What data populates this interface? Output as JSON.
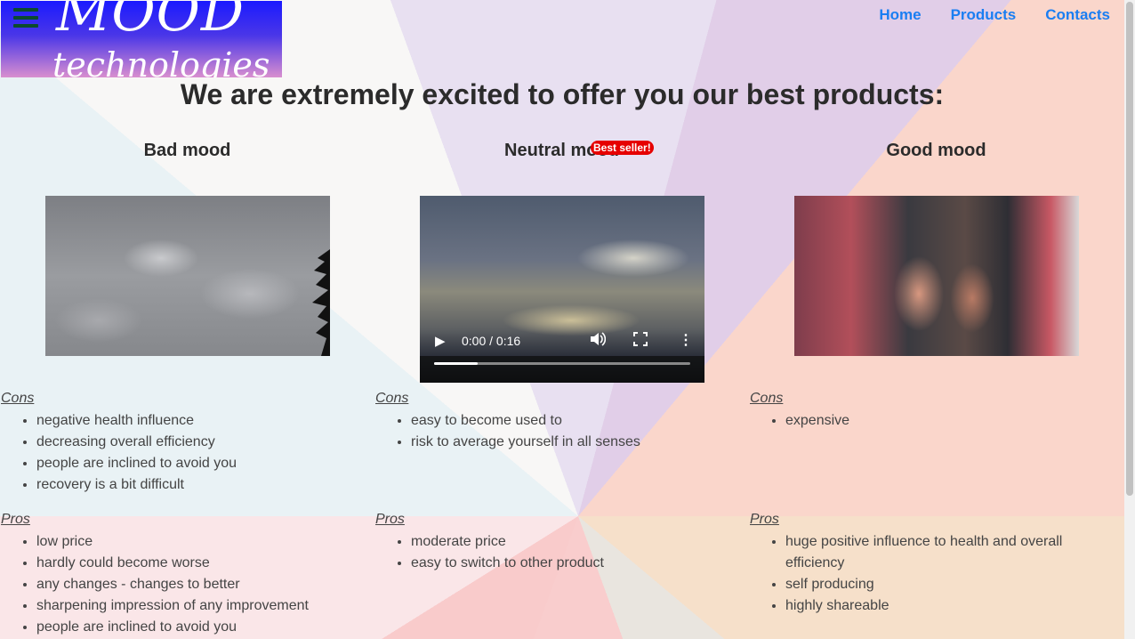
{
  "logo": {
    "line1": "MOOD",
    "line2": "technologies",
    "menu_icon": "hamburger-menu-icon"
  },
  "nav": {
    "items": [
      "Home",
      "Products",
      "Contacts"
    ]
  },
  "heading": "We are extremely excited to offer you our best products:",
  "products": [
    {
      "title": "Bad mood",
      "badge": "",
      "cons_label": "Cons",
      "cons": [
        "negative health influence",
        "decreasing overall efficiency",
        "people are inclined to avoid you",
        "recovery is a bit difficult"
      ],
      "pros_label": "Pros",
      "pros": [
        "low price",
        "hardly could become worse",
        "any changes - changes to better",
        "sharpening impression of any improvement",
        "people are inclined to avoid you"
      ]
    },
    {
      "title": "Neutral mood",
      "badge": "Best seller!",
      "video": {
        "time": "0:00 / 0:16",
        "progress": 0.17,
        "play_icon": "play-icon",
        "volume_icon": "volume-icon",
        "fullscreen_icon": "fullscreen-icon",
        "more_icon": "more-options-icon"
      },
      "cons_label": "Cons",
      "cons": [
        "easy to become used to",
        "risk to average yourself in all senses"
      ],
      "pros_label": "Pros",
      "pros": [
        "moderate price",
        "easy to switch to other product"
      ]
    },
    {
      "title": "Good mood",
      "badge": "",
      "cons_label": "Cons",
      "cons": [
        "expensive"
      ],
      "pros_label": "Pros",
      "pros": [
        "huge positive influence to health and overall efficiency",
        "self producing",
        "highly shareable"
      ]
    }
  ],
  "colors": {
    "nav_link": "#1a7ef2",
    "badge": "#e60000",
    "logo_top": "#1a1aff",
    "logo_bottom": "#d98fcf"
  }
}
